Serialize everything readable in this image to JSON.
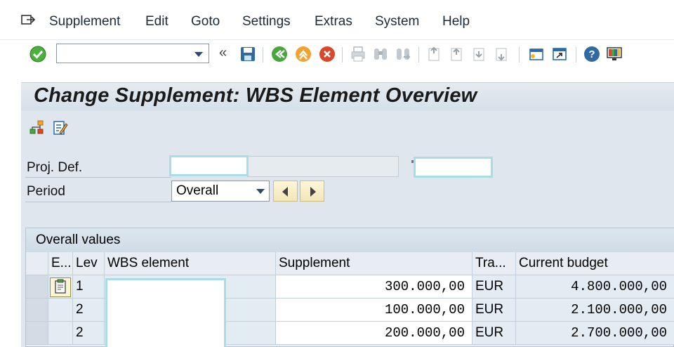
{
  "menu": {
    "items": [
      "Supplement",
      "Edit",
      "Goto",
      "Settings",
      "Extras",
      "System",
      "Help"
    ]
  },
  "toolbar": {
    "command_value": "",
    "icons": [
      "enter-check-icon",
      "save-icon",
      "back-icon",
      "exit-icon",
      "cancel-icon",
      "print-icon",
      "find-icon",
      "find-next-icon",
      "first-page-icon",
      "previous-page-icon",
      "next-page-icon",
      "last-page-icon",
      "create-session-icon",
      "shortcut-icon",
      "help-icon",
      "customize-layout-icon"
    ]
  },
  "page": {
    "title": "Change Supplement: WBS Element Overview"
  },
  "app_toolbar": {
    "icons": [
      "hierarchy-icon",
      "edit-text-icon"
    ]
  },
  "form": {
    "proj_def_label": "Proj. Def.",
    "proj_def_value": "",
    "period_label": "Period",
    "period_value": "Overall"
  },
  "table": {
    "caption": "Overall values",
    "headers": {
      "e": "E...",
      "lev": "Lev",
      "wbs": "WBS element",
      "supplement": "Supplement",
      "tra": "Tra...",
      "current_budget": "Current budget"
    },
    "rows": [
      {
        "lev": "1",
        "wbs": "",
        "supplement": "300.000,00",
        "currency": "EUR",
        "current_budget": "4.800.000,00"
      },
      {
        "lev": "2",
        "wbs": "",
        "supplement": "100.000,00",
        "currency": "EUR",
        "current_budget": "2.100.000,00"
      },
      {
        "lev": "2",
        "wbs": "",
        "supplement": "200.000,00",
        "currency": "EUR",
        "current_budget": "2.700.000,00"
      }
    ]
  },
  "colors": {
    "title_bg": "#d6e0e9",
    "panel_bg": "#dfe6ed",
    "highlight_border": "#a9dde6",
    "nav_button": "#f3e7b6"
  }
}
